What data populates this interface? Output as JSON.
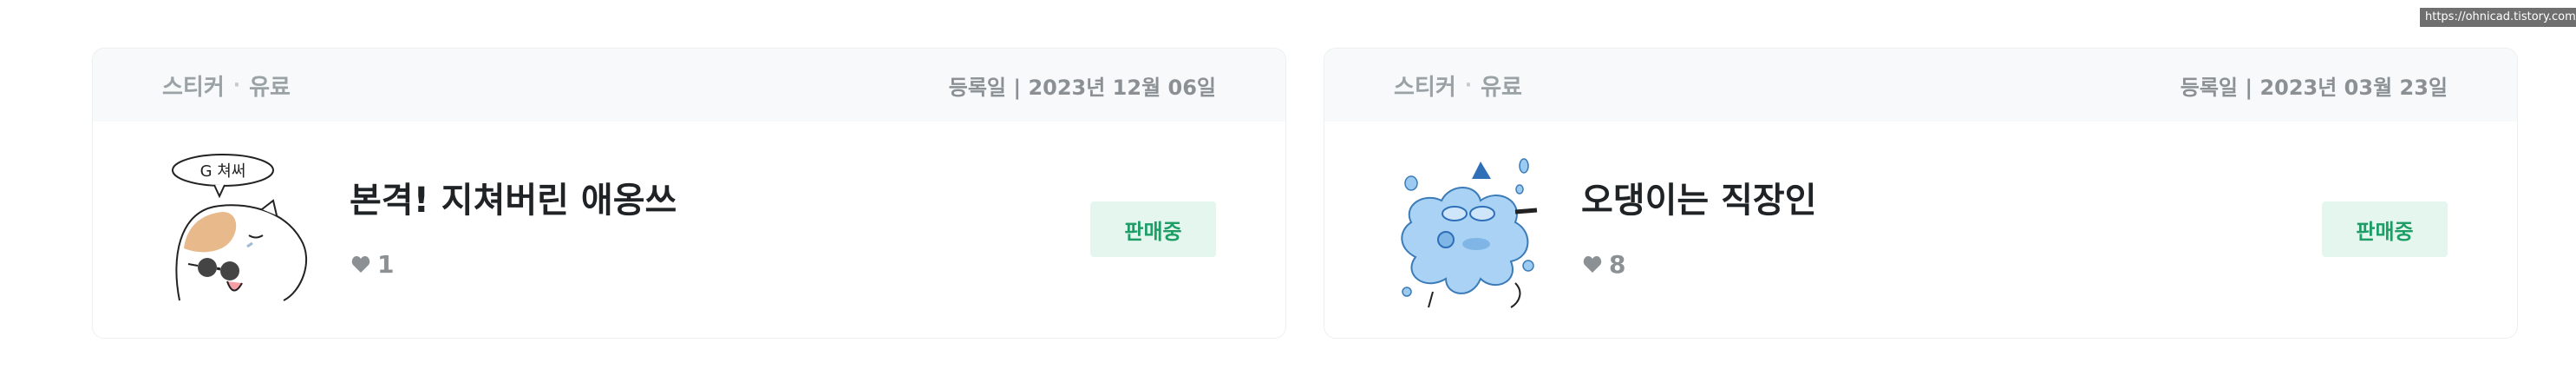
{
  "status_bar": {
    "url": "https://ohnicad.tistory.com/manage/newpost/?type=p"
  },
  "products": [
    {
      "category": "스티커",
      "category_sep": "·",
      "pricing": "유료",
      "reg_date": "등록일 | 2023년 12월 06일",
      "title": "본격! 지쳐버린 애옹쓰",
      "likes": "1",
      "status": "판매중",
      "thumbnail_icon": "tired-cat-sticker-icon",
      "speech_text": "G 쳐써"
    },
    {
      "category": "스티커",
      "category_sep": "·",
      "pricing": "유료",
      "reg_date": "등록일 | 2023년 03월 23일",
      "title": "오댕이는 직장인",
      "likes": "8",
      "status": "판매중",
      "thumbnail_icon": "splash-cat-sticker-icon"
    }
  ],
  "colors": {
    "status_bg": "#e4f6ee",
    "status_text": "#1f9d66",
    "header_bg": "#f7f9fa"
  }
}
